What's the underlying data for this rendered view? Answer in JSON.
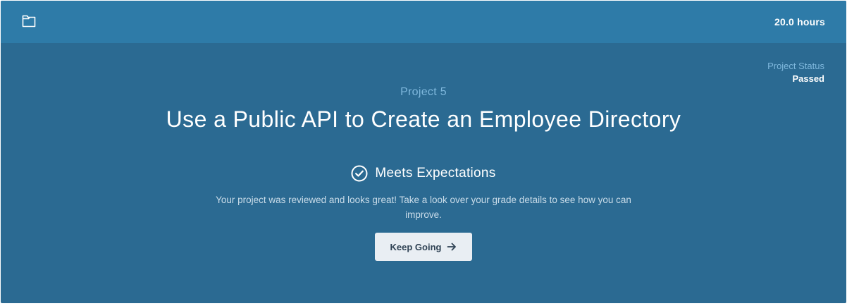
{
  "header": {
    "folder_icon": "folder-icon",
    "hours": "20.0 hours"
  },
  "status": {
    "label": "Project Status",
    "value": "Passed"
  },
  "project": {
    "number": "Project 5",
    "title": "Use a Public API to Create an Employee Directory"
  },
  "result": {
    "icon": "check-circle-icon",
    "label": "Meets Expectations",
    "message": "Your project was reviewed and looks great! Take a look over your grade details to see how you can improve."
  },
  "action": {
    "label": "Keep Going",
    "icon": "arrow-right-icon"
  },
  "colors": {
    "background": "#2b6a92",
    "header": "#2e7ba8",
    "accent_text": "#7fb8dd",
    "button_bg": "#e9eef3",
    "button_text": "#2f4254"
  }
}
